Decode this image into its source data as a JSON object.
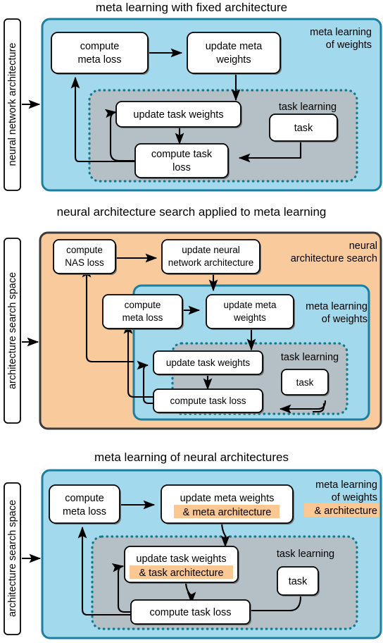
{
  "colors": {
    "blue_fill": "#a3d9ec",
    "blue_stroke": "#1a7fa0",
    "orange_fill": "#f9cb9c",
    "orange_stroke": "#3b3b3b",
    "gray_fill": "#b4c0c6",
    "teal_dotted": "#16798f",
    "highlight": "#fbc793",
    "box_fill": "#ffffff",
    "box_stroke": "#000000",
    "shadow": "#6b6b6b",
    "text": "#000000",
    "page_bg": "#ffffff"
  },
  "panels": [
    {
      "id": "panel-fixed-architecture",
      "title": "meta learning with fixed architecture",
      "input_label": "neural network architecture",
      "outer_region_label_lines": [
        "meta learning",
        "of weights"
      ],
      "outer_region_kind": "meta-learning-of-weights",
      "inner_region_label_lines": [
        "task learning"
      ],
      "nodes": [
        {
          "id": "compute-meta-loss",
          "lines": [
            "compute",
            "meta loss"
          ]
        },
        {
          "id": "update-meta-weights",
          "lines": [
            "update meta",
            "weights"
          ]
        },
        {
          "id": "update-task-weights",
          "lines": [
            "update task weights"
          ]
        },
        {
          "id": "compute-task-loss",
          "lines": [
            "compute task",
            "loss"
          ]
        },
        {
          "id": "task",
          "lines": [
            "task"
          ]
        }
      ],
      "edges": [
        {
          "from": "compute-meta-loss",
          "to": "update-meta-weights"
        },
        {
          "from": "update-meta-weights",
          "to": "update-task-weights"
        },
        {
          "from": "update-task-weights",
          "to": "compute-task-loss"
        },
        {
          "from": "compute-task-loss",
          "to": "update-task-weights"
        },
        {
          "from": "compute-task-loss",
          "to": "compute-meta-loss"
        },
        {
          "from": "task",
          "to": "compute-task-loss"
        },
        {
          "from": "input",
          "to": "panel"
        }
      ]
    },
    {
      "id": "panel-nas-applied",
      "title": "neural architecture search applied to meta learning",
      "input_label": "architecture search space",
      "outer_region_label_lines": [
        "neural",
        "architecture search"
      ],
      "outer_region_kind": "neural-architecture-search",
      "mid_region_label_lines": [
        "meta learning",
        "of weights"
      ],
      "inner_region_label_lines": [
        "task learning"
      ],
      "nodes": [
        {
          "id": "compute-nas-loss",
          "lines": [
            "compute",
            "NAS loss"
          ]
        },
        {
          "id": "update-neural-network-architecture",
          "lines": [
            "update neural",
            "network architecture"
          ]
        },
        {
          "id": "compute-meta-loss",
          "lines": [
            "compute",
            "meta loss"
          ]
        },
        {
          "id": "update-meta-weights",
          "lines": [
            "update meta",
            "weights"
          ]
        },
        {
          "id": "update-task-weights",
          "lines": [
            "update task weights"
          ]
        },
        {
          "id": "compute-task-loss",
          "lines": [
            "compute task loss"
          ]
        },
        {
          "id": "task",
          "lines": [
            "task"
          ]
        }
      ],
      "edges": [
        {
          "from": "compute-nas-loss",
          "to": "update-neural-network-architecture"
        },
        {
          "from": "update-neural-network-architecture",
          "to": "compute-meta-loss-region"
        },
        {
          "from": "compute-meta-loss",
          "to": "update-meta-weights"
        },
        {
          "from": "update-meta-weights",
          "to": "update-task-weights"
        },
        {
          "from": "update-task-weights",
          "to": "compute-task-loss"
        },
        {
          "from": "compute-task-loss",
          "to": "update-task-weights"
        },
        {
          "from": "compute-task-loss",
          "to": "compute-meta-loss"
        },
        {
          "from": "compute-task-loss",
          "to": "compute-nas-loss"
        },
        {
          "from": "task",
          "to": "compute-task-loss"
        },
        {
          "from": "input",
          "to": "panel"
        }
      ]
    },
    {
      "id": "panel-meta-learning-architectures",
      "title": "meta learning of neural architectures",
      "input_label": "architecture search space",
      "outer_region_label_lines": [
        "meta learning",
        "of weights"
      ],
      "outer_region_highlight_line": "& architecture",
      "outer_region_kind": "meta-learning-of-weights-and-architecture",
      "inner_region_label_lines": [
        "task learning"
      ],
      "nodes": [
        {
          "id": "compute-meta-loss",
          "lines": [
            "compute",
            "meta loss"
          ]
        },
        {
          "id": "update-meta-weights",
          "lines": [
            "update meta weights"
          ],
          "highlight_line": "& meta architecture"
        },
        {
          "id": "update-task-weights",
          "lines": [
            "update task weights"
          ],
          "highlight_line": "& task architecture"
        },
        {
          "id": "compute-task-loss",
          "lines": [
            "compute task loss"
          ]
        },
        {
          "id": "task",
          "lines": [
            "task"
          ]
        }
      ],
      "edges": [
        {
          "from": "compute-meta-loss",
          "to": "update-meta-weights"
        },
        {
          "from": "update-meta-weights",
          "to": "update-task-weights"
        },
        {
          "from": "update-task-weights",
          "to": "compute-task-loss"
        },
        {
          "from": "compute-task-loss",
          "to": "update-task-weights"
        },
        {
          "from": "compute-task-loss",
          "to": "compute-meta-loss"
        },
        {
          "from": "task",
          "to": "compute-task-loss"
        },
        {
          "from": "input",
          "to": "panel"
        }
      ]
    }
  ]
}
